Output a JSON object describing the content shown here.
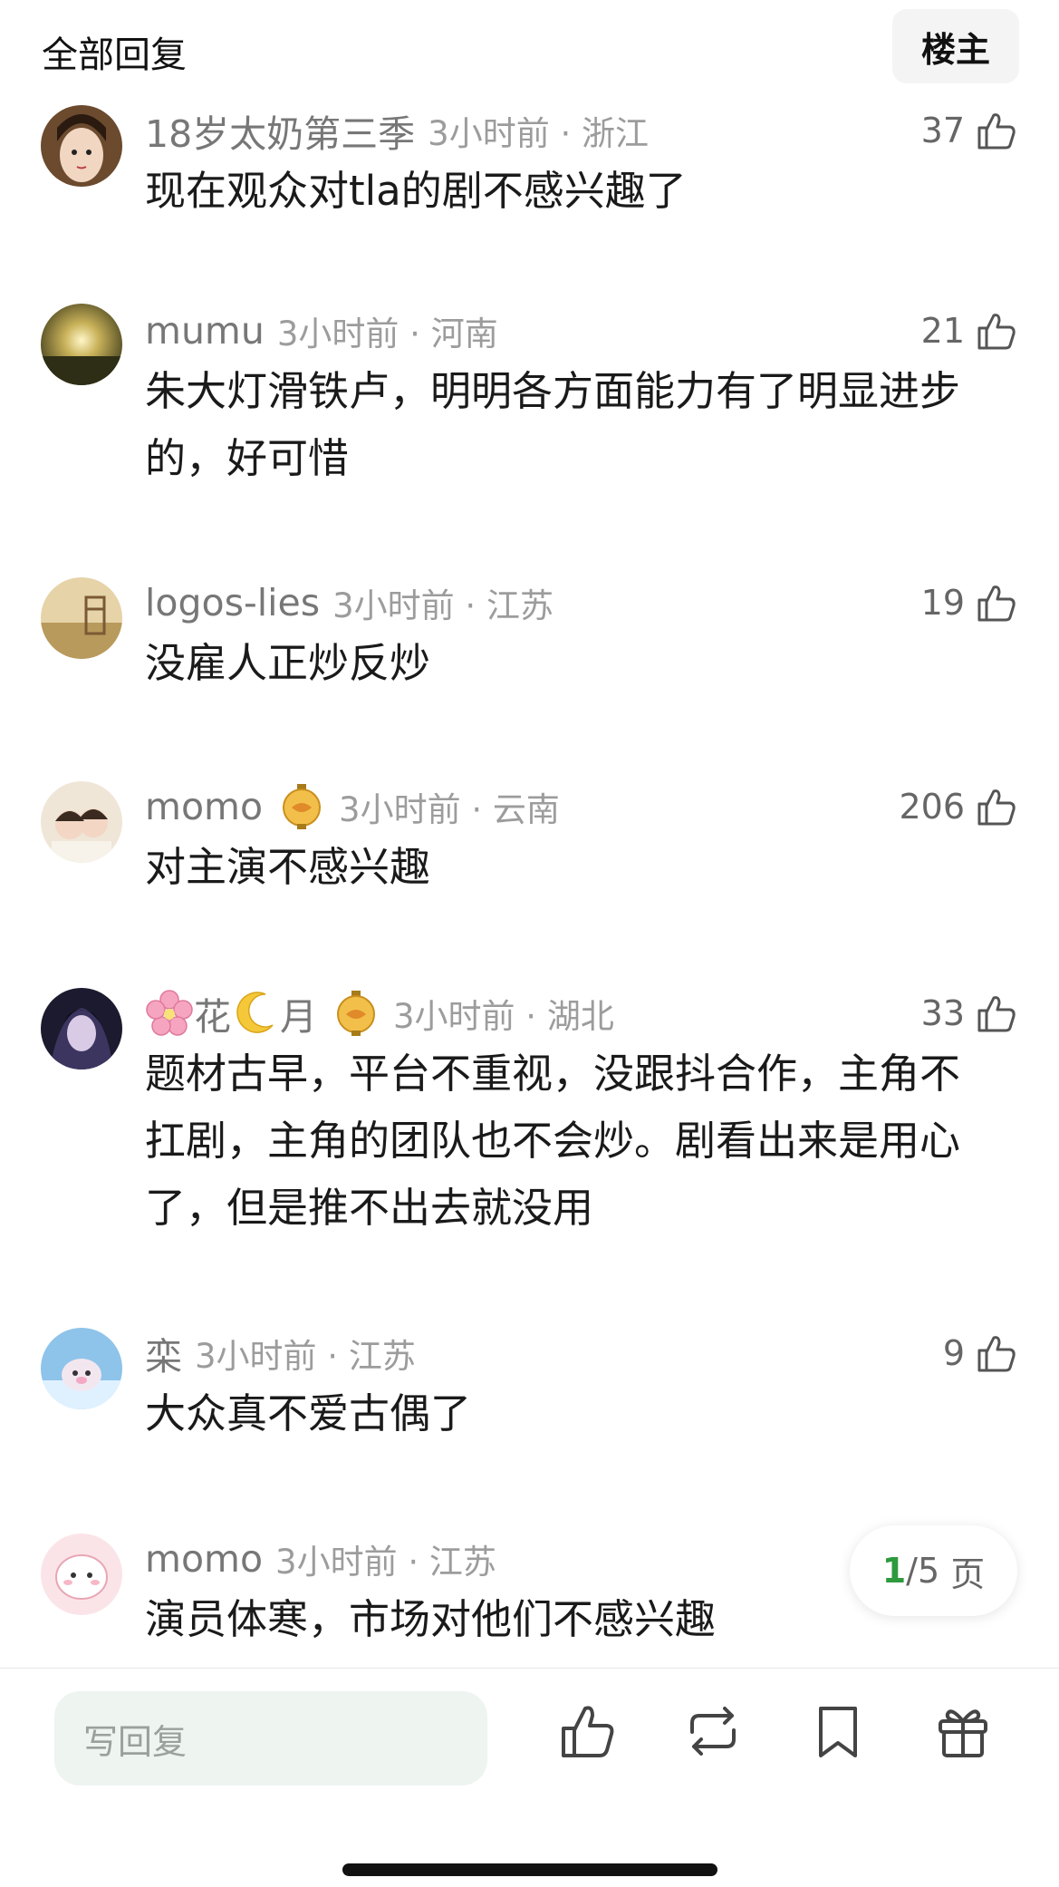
{
  "header": {
    "title": "全部回复",
    "op_label": "楼主"
  },
  "comments": [
    {
      "username": "18岁太奶第三季",
      "time": "3小时前",
      "location": "浙江",
      "likes": "37",
      "text": "现在观众对tla的剧不感兴趣了",
      "avatar": "portrait-avatar"
    },
    {
      "username": "mumu",
      "time": "3小时前",
      "location": "河南",
      "likes": "21",
      "text": "朱大灯滑铁卢，明明各方面能力有了明显进步的，好可惜",
      "avatar": "sunset-avatar"
    },
    {
      "username": "logos-lies",
      "time": "3小时前",
      "location": "江苏",
      "likes": "19",
      "text": "没雇人正炒反炒",
      "avatar": "field-avatar"
    },
    {
      "username": "momo",
      "time": "3小时前",
      "location": "云南",
      "likes": "206",
      "text": "对主演不感兴趣",
      "avatar": "couple-avatar",
      "badge": "lantern-badge"
    },
    {
      "username_parts": [
        "花",
        "月"
      ],
      "time": "3小时前",
      "location": "湖北",
      "likes": "33",
      "text": "题材古早，平台不重视，没跟抖合作，主角不扛剧，主角的团队也不会炒。剧看出来是用心了，但是推不出去就没用",
      "avatar": "anime-avatar",
      "badge": "lantern-badge"
    },
    {
      "username": "栾",
      "time": "3小时前",
      "location": "江苏",
      "likes": "9",
      "text": "大众真不爱古偶了",
      "avatar": "cartoon-avatar"
    },
    {
      "username": "momo",
      "time": "3小时前",
      "location": "江苏",
      "likes": "",
      "text": "演员体寒，市场对他们不感兴趣",
      "avatar": "pink-cartoon-avatar"
    }
  ],
  "pagination": {
    "current": "1",
    "total": "/5",
    "suffix": "页"
  },
  "bottom_bar": {
    "reply_placeholder": "写回复"
  },
  "colors": {
    "accent": "#2e9a3e",
    "meta_gray": "#9c9c9c"
  }
}
